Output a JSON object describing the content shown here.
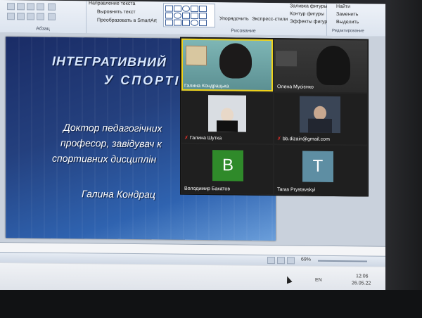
{
  "ribbon": {
    "paragraph_label": "Абзац",
    "drawing_label": "Рисование",
    "editing_label": "Редактирование",
    "text_direction": "Направление текста",
    "align_text": "Выровнять текст",
    "convert_smartart": "Преобразовать в SmartArt",
    "arrange": "Упорядочить",
    "express_styles": "Экспресс-стили",
    "shape_fill": "Заливка фигуры",
    "shape_outline": "Контур фигуры",
    "shape_effects": "Эффекты фигур",
    "find": "Найти",
    "replace": "Заменить",
    "select": "Выделить"
  },
  "slide": {
    "title_line1": "ІНТЕГРАТИВНИЙ",
    "title_line2": "У  СПОРТІ",
    "line1": "Доктор педагогічних",
    "line2": "професор, завідувач к",
    "line3": "спортивних дисциплін",
    "author": "Галина  Кондрац"
  },
  "statusbar": {
    "zoom": "69%"
  },
  "taskbar": {
    "lang": "EN",
    "time": "12:06",
    "date": "26.05.22"
  },
  "zoom": {
    "participants": [
      {
        "name": "Галина Кондрацька",
        "muted": false
      },
      {
        "name": "Олена Мусієнко",
        "muted": false
      },
      {
        "name": "Галина Шутка",
        "muted": true
      },
      {
        "name": "bb.dizain@gmail.com",
        "muted": true
      },
      {
        "name": "Володимир Бакатов",
        "muted": false,
        "initial": "B",
        "color": "#2f8a2a"
      },
      {
        "name": "Taras Prystavskyi",
        "muted": false,
        "initial": "T",
        "color": "#5e8ea3"
      }
    ]
  }
}
